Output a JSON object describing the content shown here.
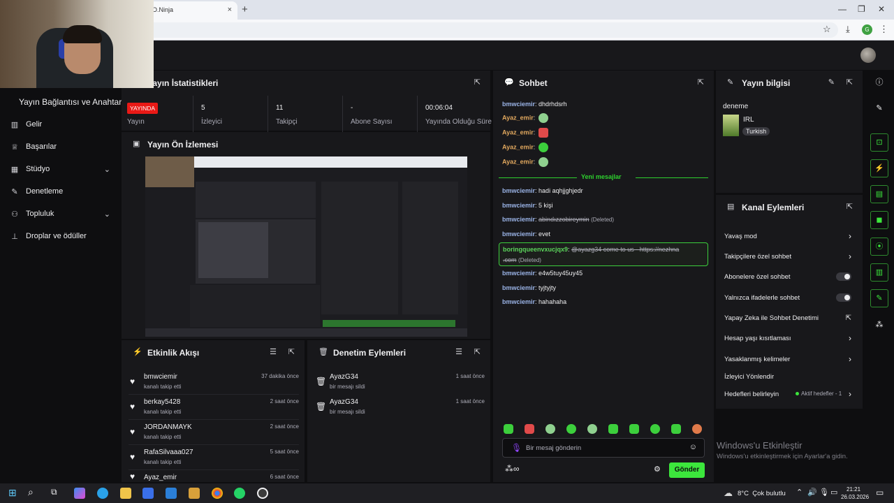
{
  "browser": {
    "tab_title": "O.Ninja",
    "tab_close": "×",
    "new_tab": "+",
    "profile_initial": "G"
  },
  "sidebar": {
    "title": "Yayın Bağlantısı ve Anahtarı",
    "items": [
      {
        "label": "Gelir",
        "icon": "chart-icon"
      },
      {
        "label": "Başarılar",
        "icon": "trophy-icon"
      },
      {
        "label": "Stüdyo",
        "icon": "studio-icon",
        "expandable": true
      },
      {
        "label": "Denetleme",
        "icon": "wrench-icon"
      },
      {
        "label": "Topluluk",
        "icon": "people-icon",
        "expandable": true
      },
      {
        "label": "Droplar ve ödüller",
        "icon": "drops-icon"
      }
    ]
  },
  "stats": {
    "title": "Yayın İstatistikleri",
    "live_badge": "YAYINDA",
    "live_label": "Yayın",
    "items": [
      {
        "value": "5",
        "label": "İzleyici"
      },
      {
        "value": "11",
        "label": "Takipçi"
      },
      {
        "value": "-",
        "label": "Abone Sayısı"
      },
      {
        "value": "00:06:04",
        "label": "Yayında Olduğu Süre"
      }
    ]
  },
  "preview": {
    "title": "Yayın Ön İzlemesi"
  },
  "activity": {
    "title": "Etkinlik Akışı",
    "events": [
      {
        "name": "bmwciemir",
        "sub": "kanalı takip etti",
        "time": "37 dakika önce"
      },
      {
        "name": "berkay5428",
        "sub": "kanalı takip etti",
        "time": "2 saat önce"
      },
      {
        "name": "JORDANMAYK",
        "sub": "kanalı takip etti",
        "time": "2 saat önce"
      },
      {
        "name": "RafaSilvaaa027",
        "sub": "kanalı takip etti",
        "time": "5 saat önce"
      },
      {
        "name": "Ayaz_emir",
        "sub": "",
        "time": "6 saat önce"
      }
    ]
  },
  "moderation": {
    "title": "Denetim Eylemleri",
    "events": [
      {
        "name": "AyazG34",
        "sub": "bir mesajı sildi",
        "time": "1 saat önce"
      },
      {
        "name": "AyazG34",
        "sub": "bir mesajı sildi",
        "time": "1 saat önce"
      }
    ]
  },
  "chat": {
    "title": "Sohbet",
    "new_messages": "Yeni mesajlar",
    "messages_before": [
      {
        "user": "bmwciemir",
        "text": "dhdrhdsrh",
        "color": "blue"
      },
      {
        "user": "Ayaz_emir",
        "text": "",
        "color": "orange",
        "emote": "#8fd08f"
      },
      {
        "user": "Ayaz_emir",
        "text": "",
        "color": "orange",
        "emote": "#e04a4a"
      },
      {
        "user": "Ayaz_emir",
        "text": "",
        "color": "orange",
        "emote": "#3ccf3c"
      },
      {
        "user": "Ayaz_emir",
        "text": "",
        "color": "orange",
        "emote": "#8fd08f"
      }
    ],
    "messages_after": [
      {
        "user": "bmwciemir",
        "text": "hadi aqhjjghjedr"
      },
      {
        "user": "bmwciemir",
        "text": "5 kişi"
      },
      {
        "user": "bmwciemir",
        "text": "abindızzobireymin",
        "deleted": "(Deleted)"
      },
      {
        "user": "bmwciemir",
        "text": "evet"
      }
    ],
    "highlighted": {
      "user": "boringqueenvxucjqx9",
      "text": "@ayazg34 come to us - https://nezhna",
      "text2": ".com",
      "deleted": "(Deleted)"
    },
    "messages_last": [
      {
        "user": "bmwciemir",
        "text": "e4w5tuy45uy45"
      },
      {
        "user": "bmwciemir",
        "text": "tyjtyjty"
      },
      {
        "user": "bmwciemir",
        "text": "hahahaha"
      }
    ],
    "input_placeholder": "Bir mesaj gönderin",
    "send_label": "Gönder",
    "emote_colors": [
      "#3ccf3c",
      "#e04a4a",
      "#8fd08f",
      "#3ccf3c",
      "#8fd08f",
      "#3ccf3c",
      "#3ccf3c",
      "#3ccf3c",
      "#3ccf3c",
      "#e07a4a"
    ]
  },
  "stream_info": {
    "title": "Yayın bilgisi",
    "stream_title": "deneme",
    "category": "IRL",
    "tag": "Turkish"
  },
  "channel_actions": {
    "title": "Kanal Eylemleri",
    "items": [
      {
        "label": "Yavaş mod",
        "type": "chevron"
      },
      {
        "label": "Takipçilere özel sohbet",
        "type": "chevron"
      },
      {
        "label": "Abonelere özel sohbet",
        "type": "toggle"
      },
      {
        "label": "Yalnızca ifadelerle sohbet",
        "type": "toggle"
      },
      {
        "label": "Yapay Zeka ile Sohbet Denetimi",
        "type": "external"
      },
      {
        "label": "Hesap yaşı kısıtlaması",
        "type": "chevron"
      },
      {
        "label": "Yasaklanmış kelimeler",
        "type": "chevron"
      },
      {
        "label": "İzleyici Yönlendir",
        "type": "none"
      },
      {
        "label": "Hedefleri belirleyin",
        "type": "chevron"
      }
    ],
    "goals_badge": "Aktif hedefler - 1"
  },
  "windows": {
    "activate_title": "Windows'u Etkinleştir",
    "activate_sub": "Windows'u etkinleştirmek için Ayarlar'a gidin.",
    "weather": "8°C  Çok bulutlu",
    "time": "21:21",
    "date": "26.03.2026"
  }
}
